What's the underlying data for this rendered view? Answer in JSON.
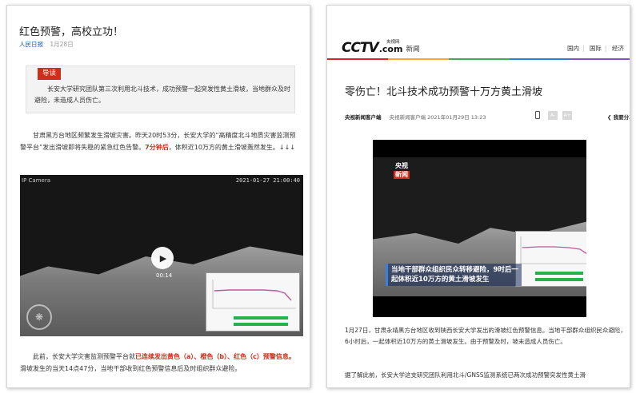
{
  "left_article": {
    "title": "红色预警，高校立功！",
    "source": "人民日报",
    "date": "1月28日",
    "lead_tag": "导读",
    "lead_text": "长安大学研究团队第三次利用北斗技术，成功预警一起突发性黄土滑坡，当地群众及时避险，未造成人员伤亡。",
    "para1_prefix": "甘肃黑方台地区频繁发生滑坡灾害。昨天20时53分，长安大学的“高精度北斗地质灾害监测预警平台”发出滑坡即将失稳的紧急红色告警。",
    "para1_red": "7分钟后",
    "para1_suffix": "，体积近10万方的黄土滑坡轰然发生。↓↓↓",
    "video": {
      "camera_label": "IP Camera",
      "timestamp": "2021-01-27 21:00:40",
      "duration": "00:14"
    },
    "para2_prefix": "此前，长安大学灾害监测预警平台就",
    "para2_red": "已连续发出黄色（a）、橙色（b）、红色（c）预警信息。",
    "para2_suffix": "滑坡发生的当天14点47分，当地干部收到红色预警信息后及时组织群众避险。"
  },
  "right_article": {
    "logo_cctv": "CCTV",
    "logo_com": ".com",
    "logo_yangshi": "央视网",
    "logo_news": "新闻",
    "nav": {
      "domestic": "国内",
      "international": "国际",
      "economy": "经济"
    },
    "title": "零伤亡！北斗技术成功预警十万方黄土滑坡",
    "source": "央视新闻客户端",
    "meta": "央视新闻客户端 2021年01月29日 13:23",
    "font_small": "A-",
    "font_large": "A+",
    "share": "我要分享",
    "video_logo_top": "央视",
    "video_logo_bottom": "新闻",
    "video_caption": "当地干部群众组织民众转移避险，9时后一起体积近10万方的黄土滑坡发生",
    "para1": "1月27日，甘肃永靖黑方台地区收到陕西长安大学发出的滑坡红色预警信息。当地干部群众组织民众避险，6小时后，一起体积近10万方的黄土滑坡发生。由于预警及时，坡未造成人员伤亡。",
    "para2": "据了解此前，长安大学这支研究团队利用北斗/GNSS监测系统已两次成功预警突发性黄土滑"
  },
  "colors": {
    "red": "#cf2e1a",
    "link_blue": "#1f5fa8",
    "play_button": "#ffffff",
    "monitor_green": "#2ab04a"
  }
}
